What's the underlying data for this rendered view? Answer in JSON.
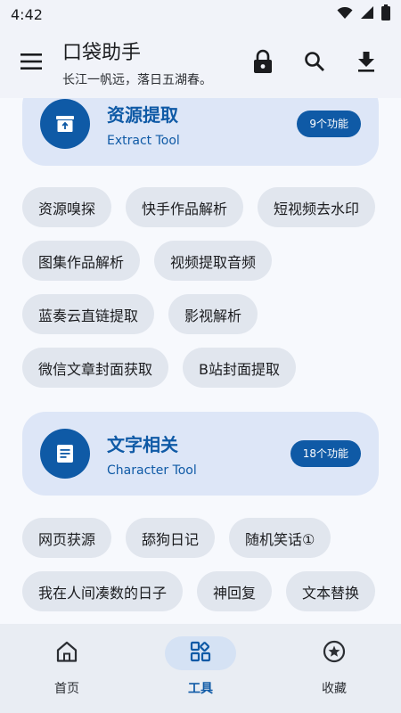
{
  "status_bar": {
    "time": "4:42",
    "icons": [
      "wifi-icon",
      "signal-icon",
      "battery-icon"
    ]
  },
  "app_bar": {
    "title": "口袋助手",
    "subtitle": "长江一帆远，落日五湖春。",
    "actions": [
      "lock-icon",
      "search-icon",
      "download-icon"
    ]
  },
  "categories": [
    {
      "title": "资源提取",
      "subtitle": "Extract Tool",
      "badge": "9个功能",
      "chips": [
        "资源嗅探",
        "快手作品解析",
        "短视频去水印",
        "图集作品解析",
        "视频提取音频",
        "蓝奏云直链提取",
        "影视解析",
        "微信文章封面获取",
        "B站封面提取"
      ]
    },
    {
      "title": "文字相关",
      "subtitle": "Character Tool",
      "badge": "18个功能",
      "chips": [
        "网页获源",
        "舔狗日记",
        "随机笑话①",
        "我在人间凑数的日子",
        "神回复",
        "文本替换"
      ]
    }
  ],
  "bottom_nav": {
    "items": [
      {
        "label": "首页",
        "icon": "home-icon"
      },
      {
        "label": "工具",
        "icon": "tools-icon"
      },
      {
        "label": "收藏",
        "icon": "star-icon"
      }
    ],
    "active": "工具"
  },
  "colors": {
    "accent": "#0f5aa6",
    "card": "#dde6f7",
    "chip": "#e1e6ee",
    "background": "#f7f9fd"
  }
}
